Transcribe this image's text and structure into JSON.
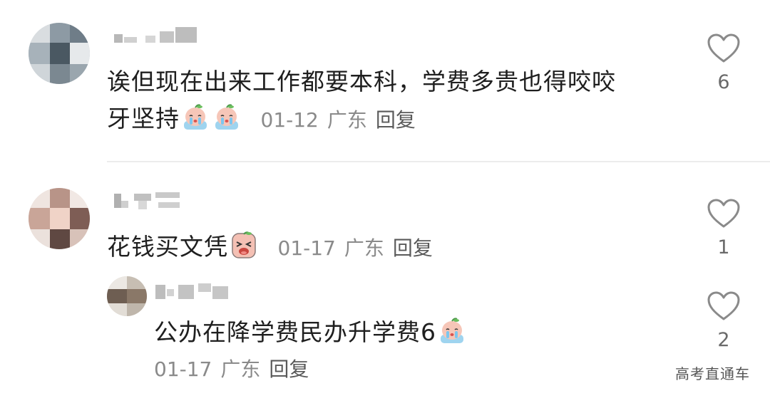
{
  "comments": [
    {
      "text_main": "诶但现在出来工作都要本科，学费多贵也得咬咬",
      "text_cont": "牙坚持",
      "emoji": [
        "crying-peach-emoji",
        "crying-peach-emoji"
      ],
      "date": "01-12",
      "location": "广东",
      "reply": "回复",
      "likes": "6"
    },
    {
      "text": "花钱买文凭",
      "emoji": [
        "sobbing-peach-emoji"
      ],
      "date": "01-17",
      "location": "广东",
      "reply": "回复",
      "likes": "1",
      "replies": [
        {
          "text": "公办在降学费民办升学费6",
          "emoji": [
            "crying-peach-emoji"
          ],
          "date": "01-17",
          "location": "广东",
          "reply": "回复",
          "likes": "2"
        }
      ]
    }
  ],
  "watermark": "高考直通车",
  "colors": {
    "text": "#1f1f1f",
    "meta": "#8a8a8a",
    "divider": "#ececec",
    "heart_outline": "#8a8a8a"
  }
}
